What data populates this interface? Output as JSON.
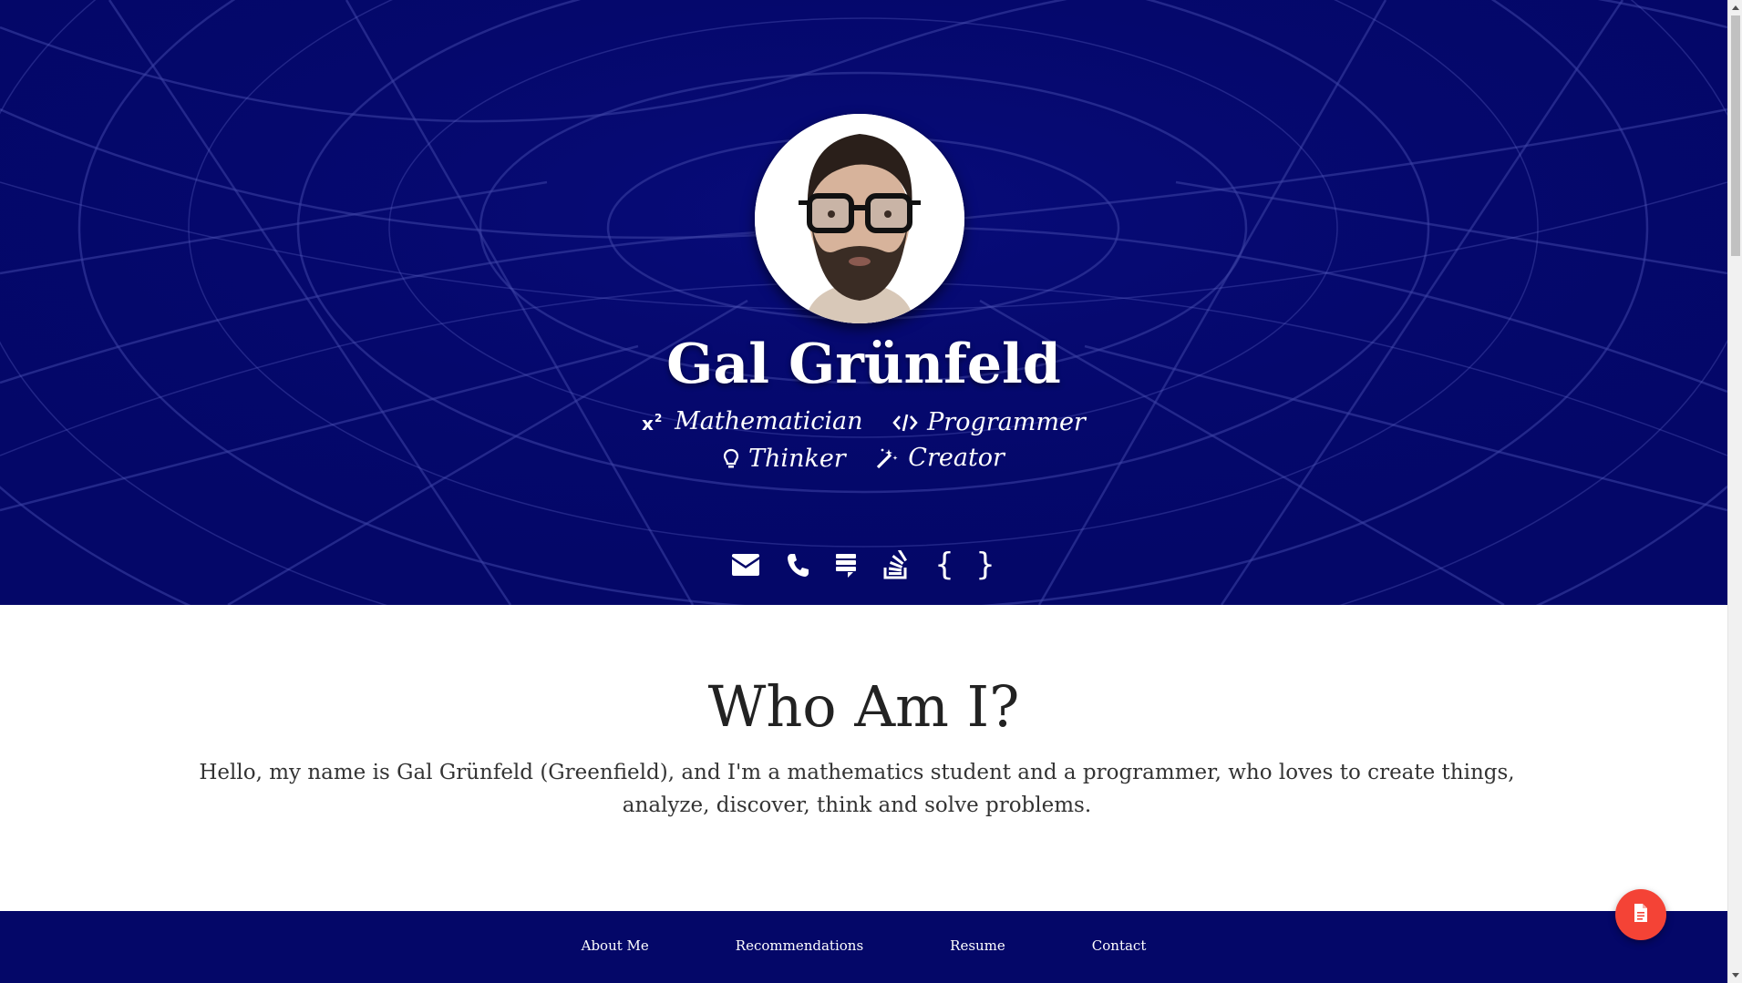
{
  "hero": {
    "name": "Gal Grünfeld",
    "roles_row1": [
      {
        "icon": "superscript-x2-icon",
        "label": "Mathematician"
      },
      {
        "icon": "code-icon",
        "label": "Programmer"
      }
    ],
    "roles_row2": [
      {
        "icon": "lightbulb-icon",
        "label": "Thinker"
      },
      {
        "icon": "magic-wand-icon",
        "label": "Creator"
      }
    ],
    "socials": [
      {
        "icon": "envelope-icon"
      },
      {
        "icon": "phone-icon"
      },
      {
        "icon": "medium-icon"
      },
      {
        "icon": "stack-overflow-icon"
      },
      {
        "icon": "json-braces-icon",
        "label": "{ }"
      }
    ]
  },
  "about": {
    "title": "Who Am I?",
    "text": "Hello, my name is Gal Grünfeld (Greenfield), and I'm a mathematics student and a programmer, who loves to create things, analyze, discover, think and solve problems."
  },
  "footer": {
    "links": [
      "About Me",
      "Recommendations",
      "Resume",
      "Contact"
    ]
  },
  "fab": {
    "icon": "document-icon"
  },
  "colors": {
    "hero_bg": "#040768",
    "footer_bg": "#040768",
    "fab": "#f44336",
    "text_dark": "#222222"
  }
}
